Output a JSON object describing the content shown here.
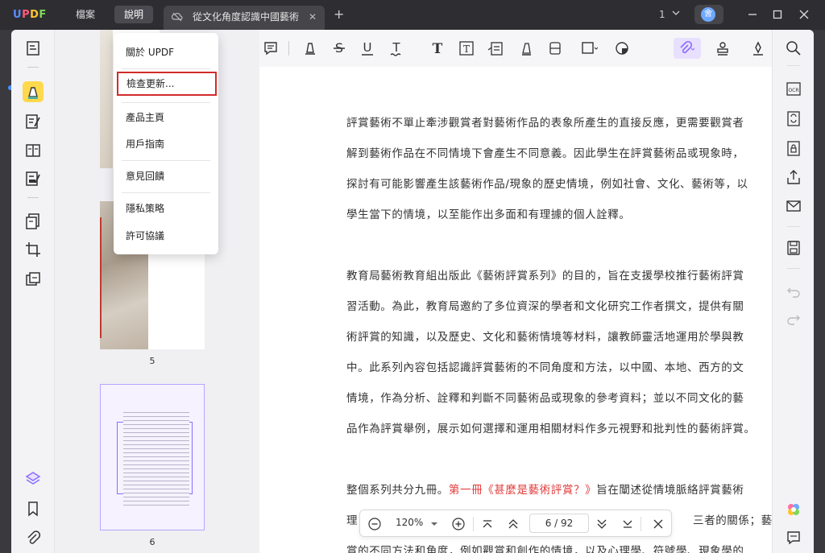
{
  "app": {
    "logo": "UPDF"
  },
  "menubar": {
    "file": "檔案",
    "help": "說明"
  },
  "tab": {
    "title": "從文化角度認識中國藝術",
    "close": "✕",
    "add": "+"
  },
  "window": {
    "page_indicator": "1",
    "avatar_initial": "舍"
  },
  "help_menu": {
    "items": [
      {
        "label": "關於 UPDF"
      },
      {
        "label": "檢查更新..."
      },
      {
        "label": "產品主頁"
      },
      {
        "label": "用戶指南"
      },
      {
        "label": "意見回饋"
      },
      {
        "label": "隱私策略"
      },
      {
        "label": "許可協議"
      }
    ]
  },
  "thumbnails": {
    "page5": "5",
    "page6": "6"
  },
  "document": {
    "lines": [
      "評賞藝術不單止牽涉觀賞者對藝術作品的表象所產生的直接反應，更需要觀賞者",
      "解到藝術作品在不同情境下會產生不同意義。因此學生在評賞藝術品或現象時，",
      "探討有可能影響產生該藝術作品/現象的歷史情境，例如社會、文化、藝術等，以",
      "學生當下的情境，以至能作出多面和有理據的個人詮釋。",
      "教育局藝術教育組出版此《藝術評賞系列》的目的，旨在支援學校推行藝術評賞",
      "習活動。為此，教育局邀約了多位資深的學者和文化研究工作者撰文，提供有關",
      "術評賞的知識，以及歷史、文化和藝術情境等材料，讓教師靈活地運用於學與教",
      "中。此系列內容包括認識評賞藝術的不同角度和方法，以中國、本地、西方的文",
      "情境，作為分析、詮釋和判斷不同藝術品或現象的參考資料；並以不同文化的藝",
      "品作為評賞舉例，展示如何選擇和運用相關材料作多元視野和批判性的藝術評賞。"
    ],
    "para3_prefix": "整個系列共分九冊。",
    "para3_red": "第一冊《甚麼是藝術評賞？》",
    "para3_suffix": "旨在闡述從情境脈絡評賞藝術",
    "line_b1_prefix": "理",
    "line_b1_suffix": "三者的關係；藝術",
    "line_b2": "賞的不同方法和角度，例如觀賞和創作的情境，以及心理學、符號學、現象學的"
  },
  "zoombar": {
    "zoom": "120%",
    "page": "6 / 92"
  },
  "colors": {
    "accent": "#8a6cff",
    "highlight": "#ffd94d",
    "menu_highlight": "#d22b2b",
    "link_red": "#e23b3b"
  }
}
